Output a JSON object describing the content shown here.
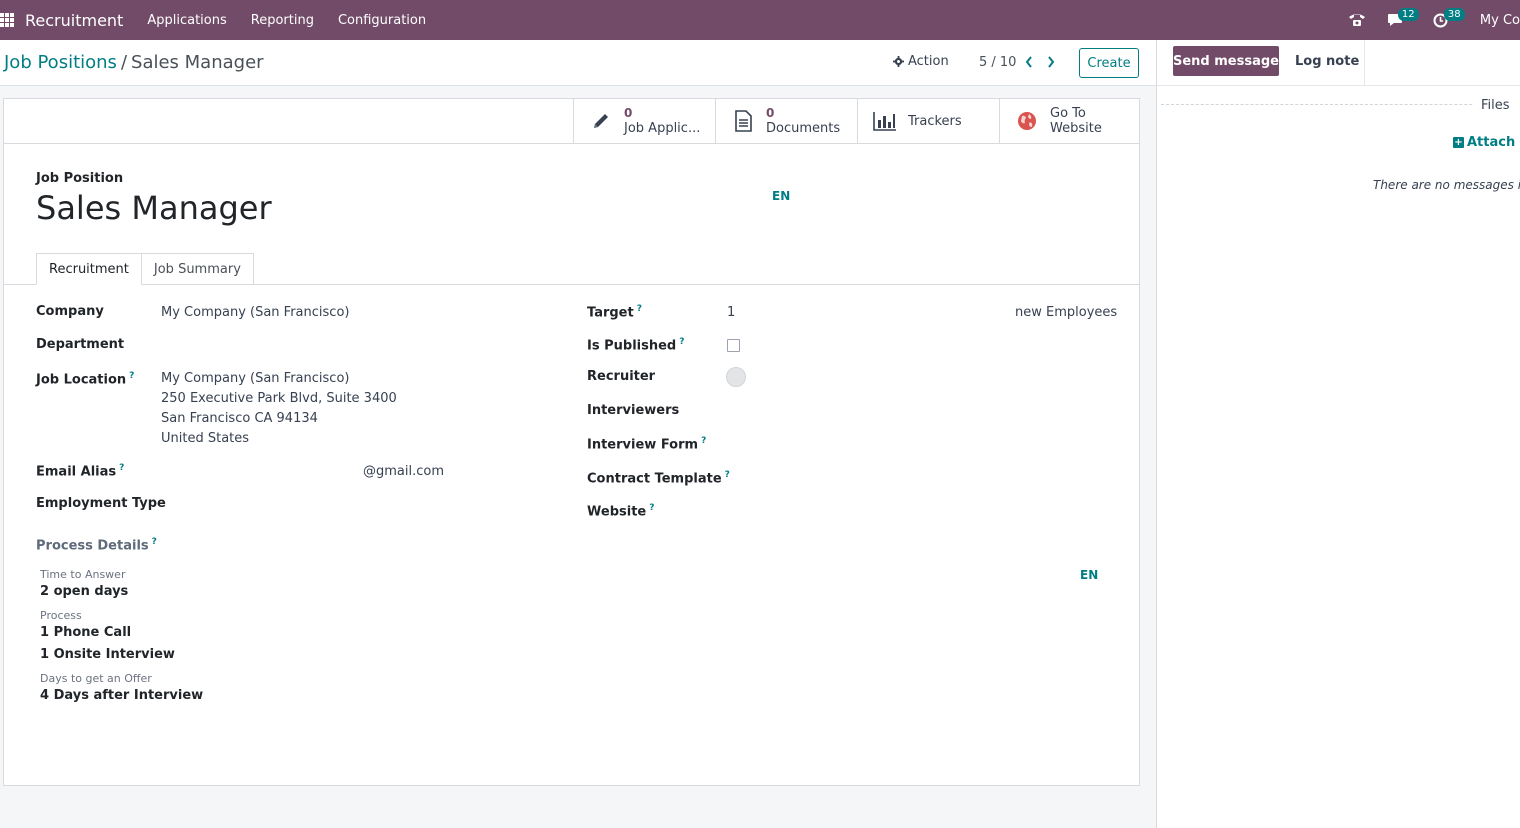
{
  "navbar": {
    "brand": "Recruitment",
    "menu": [
      "Applications",
      "Reporting",
      "Configuration"
    ],
    "messages_count": "12",
    "activities_count": "38",
    "company": "My Co"
  },
  "control_panel": {
    "breadcrumb_parent": "Job Positions",
    "breadcrumb_sep": "/",
    "breadcrumb_current": "Sales Manager",
    "action_label": "Action",
    "pager": "5 / 10",
    "create_label": "Create"
  },
  "stat_buttons": [
    {
      "value": "0",
      "label": "Job Applic..."
    },
    {
      "value": "0",
      "label": "Documents"
    },
    {
      "label": "Trackers"
    },
    {
      "line1": "Go To",
      "line2": "Website"
    }
  ],
  "form": {
    "title_label": "Job Position",
    "title_value": "Sales Manager",
    "lang": "EN",
    "tabs": [
      "Recruitment",
      "Job Summary"
    ],
    "help_mark": "?",
    "left_fields": {
      "company_label": "Company",
      "company_value": "My Company (San Francisco)",
      "department_label": "Department",
      "job_location_label": "Job Location",
      "job_location_lines": [
        "My Company (San Francisco)",
        "250 Executive Park Blvd, Suite 3400",
        "San Francisco CA 94134",
        "United States"
      ],
      "email_alias_label": "Email Alias",
      "email_domain": "@gmail.com",
      "employment_type_label": "Employment Type"
    },
    "right_fields": {
      "target_label": "Target",
      "target_value": "1",
      "target_unit": "new Employees",
      "is_published_label": "Is Published",
      "is_published": false,
      "recruiter_label": "Recruiter",
      "interviewers_label": "Interviewers",
      "interview_form_label": "Interview Form",
      "contract_template_label": "Contract Template",
      "website_label": "Website"
    },
    "process": {
      "title": "Process Details",
      "lang": "EN",
      "time_to_answer_label": "Time to Answer",
      "time_to_answer_value": "2 open days",
      "process_label": "Process",
      "process_lines": [
        "1 Phone Call",
        "1 Onsite Interview"
      ],
      "days_offer_label": "Days to get an Offer",
      "days_offer_value": "4 Days after Interview"
    }
  },
  "chatter": {
    "send_message": "Send message",
    "log_note": "Log note",
    "files": "Files",
    "attach": "Attach fi",
    "no_messages": "There are no messages in t"
  }
}
